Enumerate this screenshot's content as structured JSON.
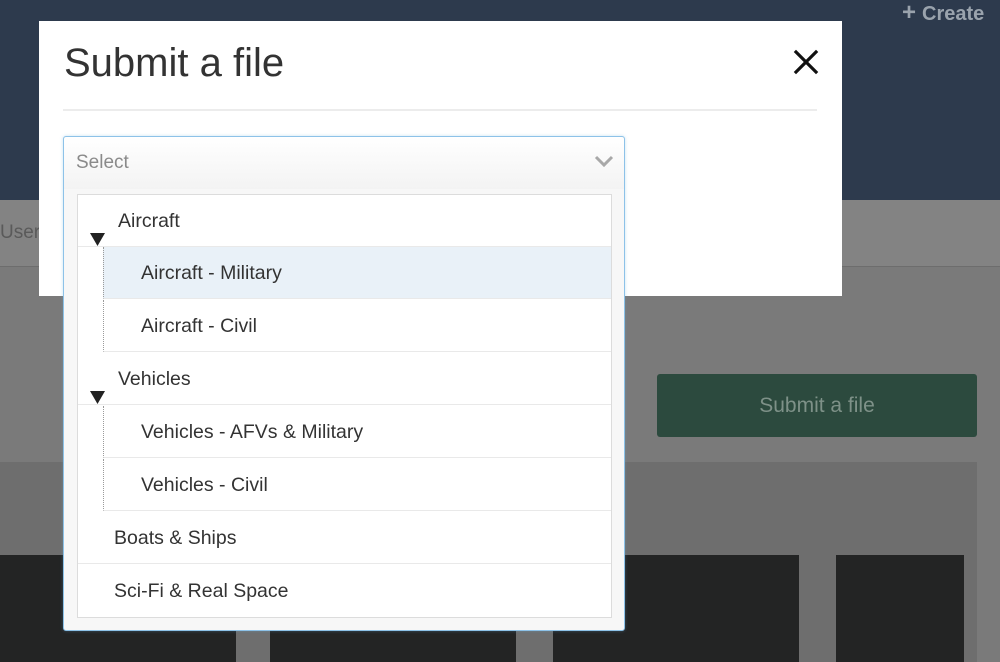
{
  "background": {
    "header_action": "Create",
    "tab_fragment": "User",
    "submit_button_label": "Submit a file"
  },
  "modal": {
    "title": "Submit a file",
    "close_icon": "close-icon"
  },
  "select": {
    "placeholder": "Select",
    "chevron_icon": "chevron-down-icon",
    "highlighted_option": "Aircraft - Military",
    "options": [
      {
        "type": "group",
        "label": "Aircraft",
        "expanded": true,
        "children": [
          "Aircraft - Military",
          "Aircraft - Civil"
        ]
      },
      {
        "type": "group",
        "label": "Vehicles",
        "expanded": true,
        "children": [
          "Vehicles - AFVs & Military",
          "Vehicles - Civil"
        ]
      },
      {
        "type": "item",
        "label": "Boats & Ships"
      },
      {
        "type": "item",
        "label": "Sci-Fi & Real Space"
      }
    ]
  },
  "colors": {
    "header_bg": "#2d3a4d",
    "overlay_bg": "#7a7a7a",
    "focus_border": "#8dc2e8",
    "highlight_bg": "#e9f1f8",
    "submit_bg": "#2c4a3e"
  }
}
